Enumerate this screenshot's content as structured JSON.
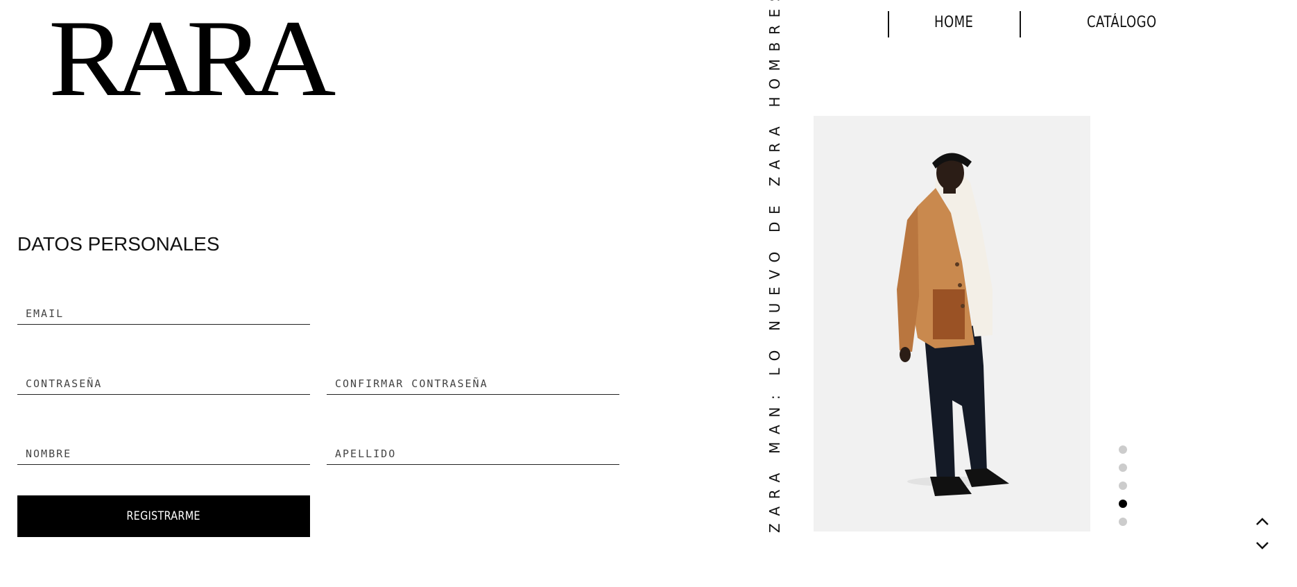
{
  "brand": {
    "logo_text": "RARA"
  },
  "nav": {
    "home": "HOME",
    "catalog": "CATÁLOGO"
  },
  "form": {
    "title": "DATOS PERSONALES",
    "email_placeholder": "EMAIL",
    "password_placeholder": "CONTRASEÑA",
    "confirm_password_placeholder": "CONFIRMAR CONTRASEÑA",
    "first_name_placeholder": "NOMBRE",
    "last_name_placeholder": "APELLIDO",
    "submit_label": "REGISTRARME"
  },
  "carousel": {
    "tagline": "ZARA MAN: LO NUEVO DE ZARA HOMBRES",
    "slide_count": 5,
    "active_slide": 4
  },
  "icons": {
    "scroll_up": "chevron-up-icon",
    "scroll_down": "chevron-down-icon"
  },
  "colors": {
    "button_bg": "#000000",
    "dot_inactive": "#cccccc",
    "dot_active": "#000000"
  }
}
